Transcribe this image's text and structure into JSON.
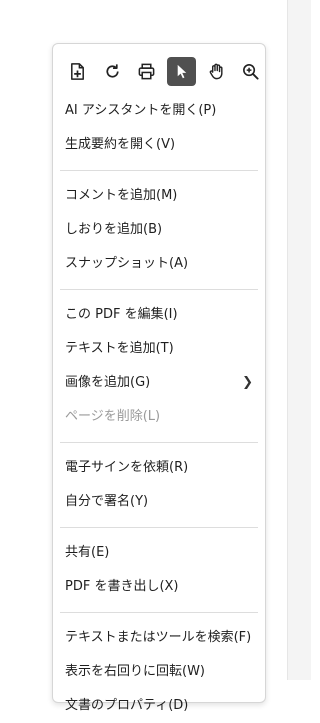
{
  "toolbar": {
    "tools": [
      {
        "icon": "page-add-icon",
        "active": false
      },
      {
        "icon": "rotate-icon",
        "active": false
      },
      {
        "icon": "print-icon",
        "active": false
      },
      {
        "icon": "select-cursor-icon",
        "active": true
      },
      {
        "icon": "hand-tool-icon",
        "active": false
      },
      {
        "icon": "zoom-in-icon",
        "active": false
      }
    ]
  },
  "menu": {
    "ai_assistant": "AI アシスタントを開く(P)",
    "gen_summary": "生成要約を開く(V)",
    "add_comment": "コメントを追加(M)",
    "add_bookmark": "しおりを追加(B)",
    "snapshot": "スナップショット(A)",
    "edit_pdf": "この PDF を編集(I)",
    "add_text": "テキストを追加(T)",
    "add_image": "画像を追加(G)",
    "delete_page": "ページを削除(L)",
    "request_esign": "電子サインを依頼(R)",
    "self_sign": "自分で署名(Y)",
    "share": "共有(E)",
    "export_pdf": "PDF を書き出し(X)",
    "search_tools": "テキストまたはツールを検索(F)",
    "rotate_view": "表示を右回りに回転(W)",
    "doc_properties": "文書のプロパティ(D)"
  },
  "colors": {
    "active_tool_bg": "#505050",
    "disabled_text": "#9a9a9a",
    "separator": "#dddddd"
  }
}
